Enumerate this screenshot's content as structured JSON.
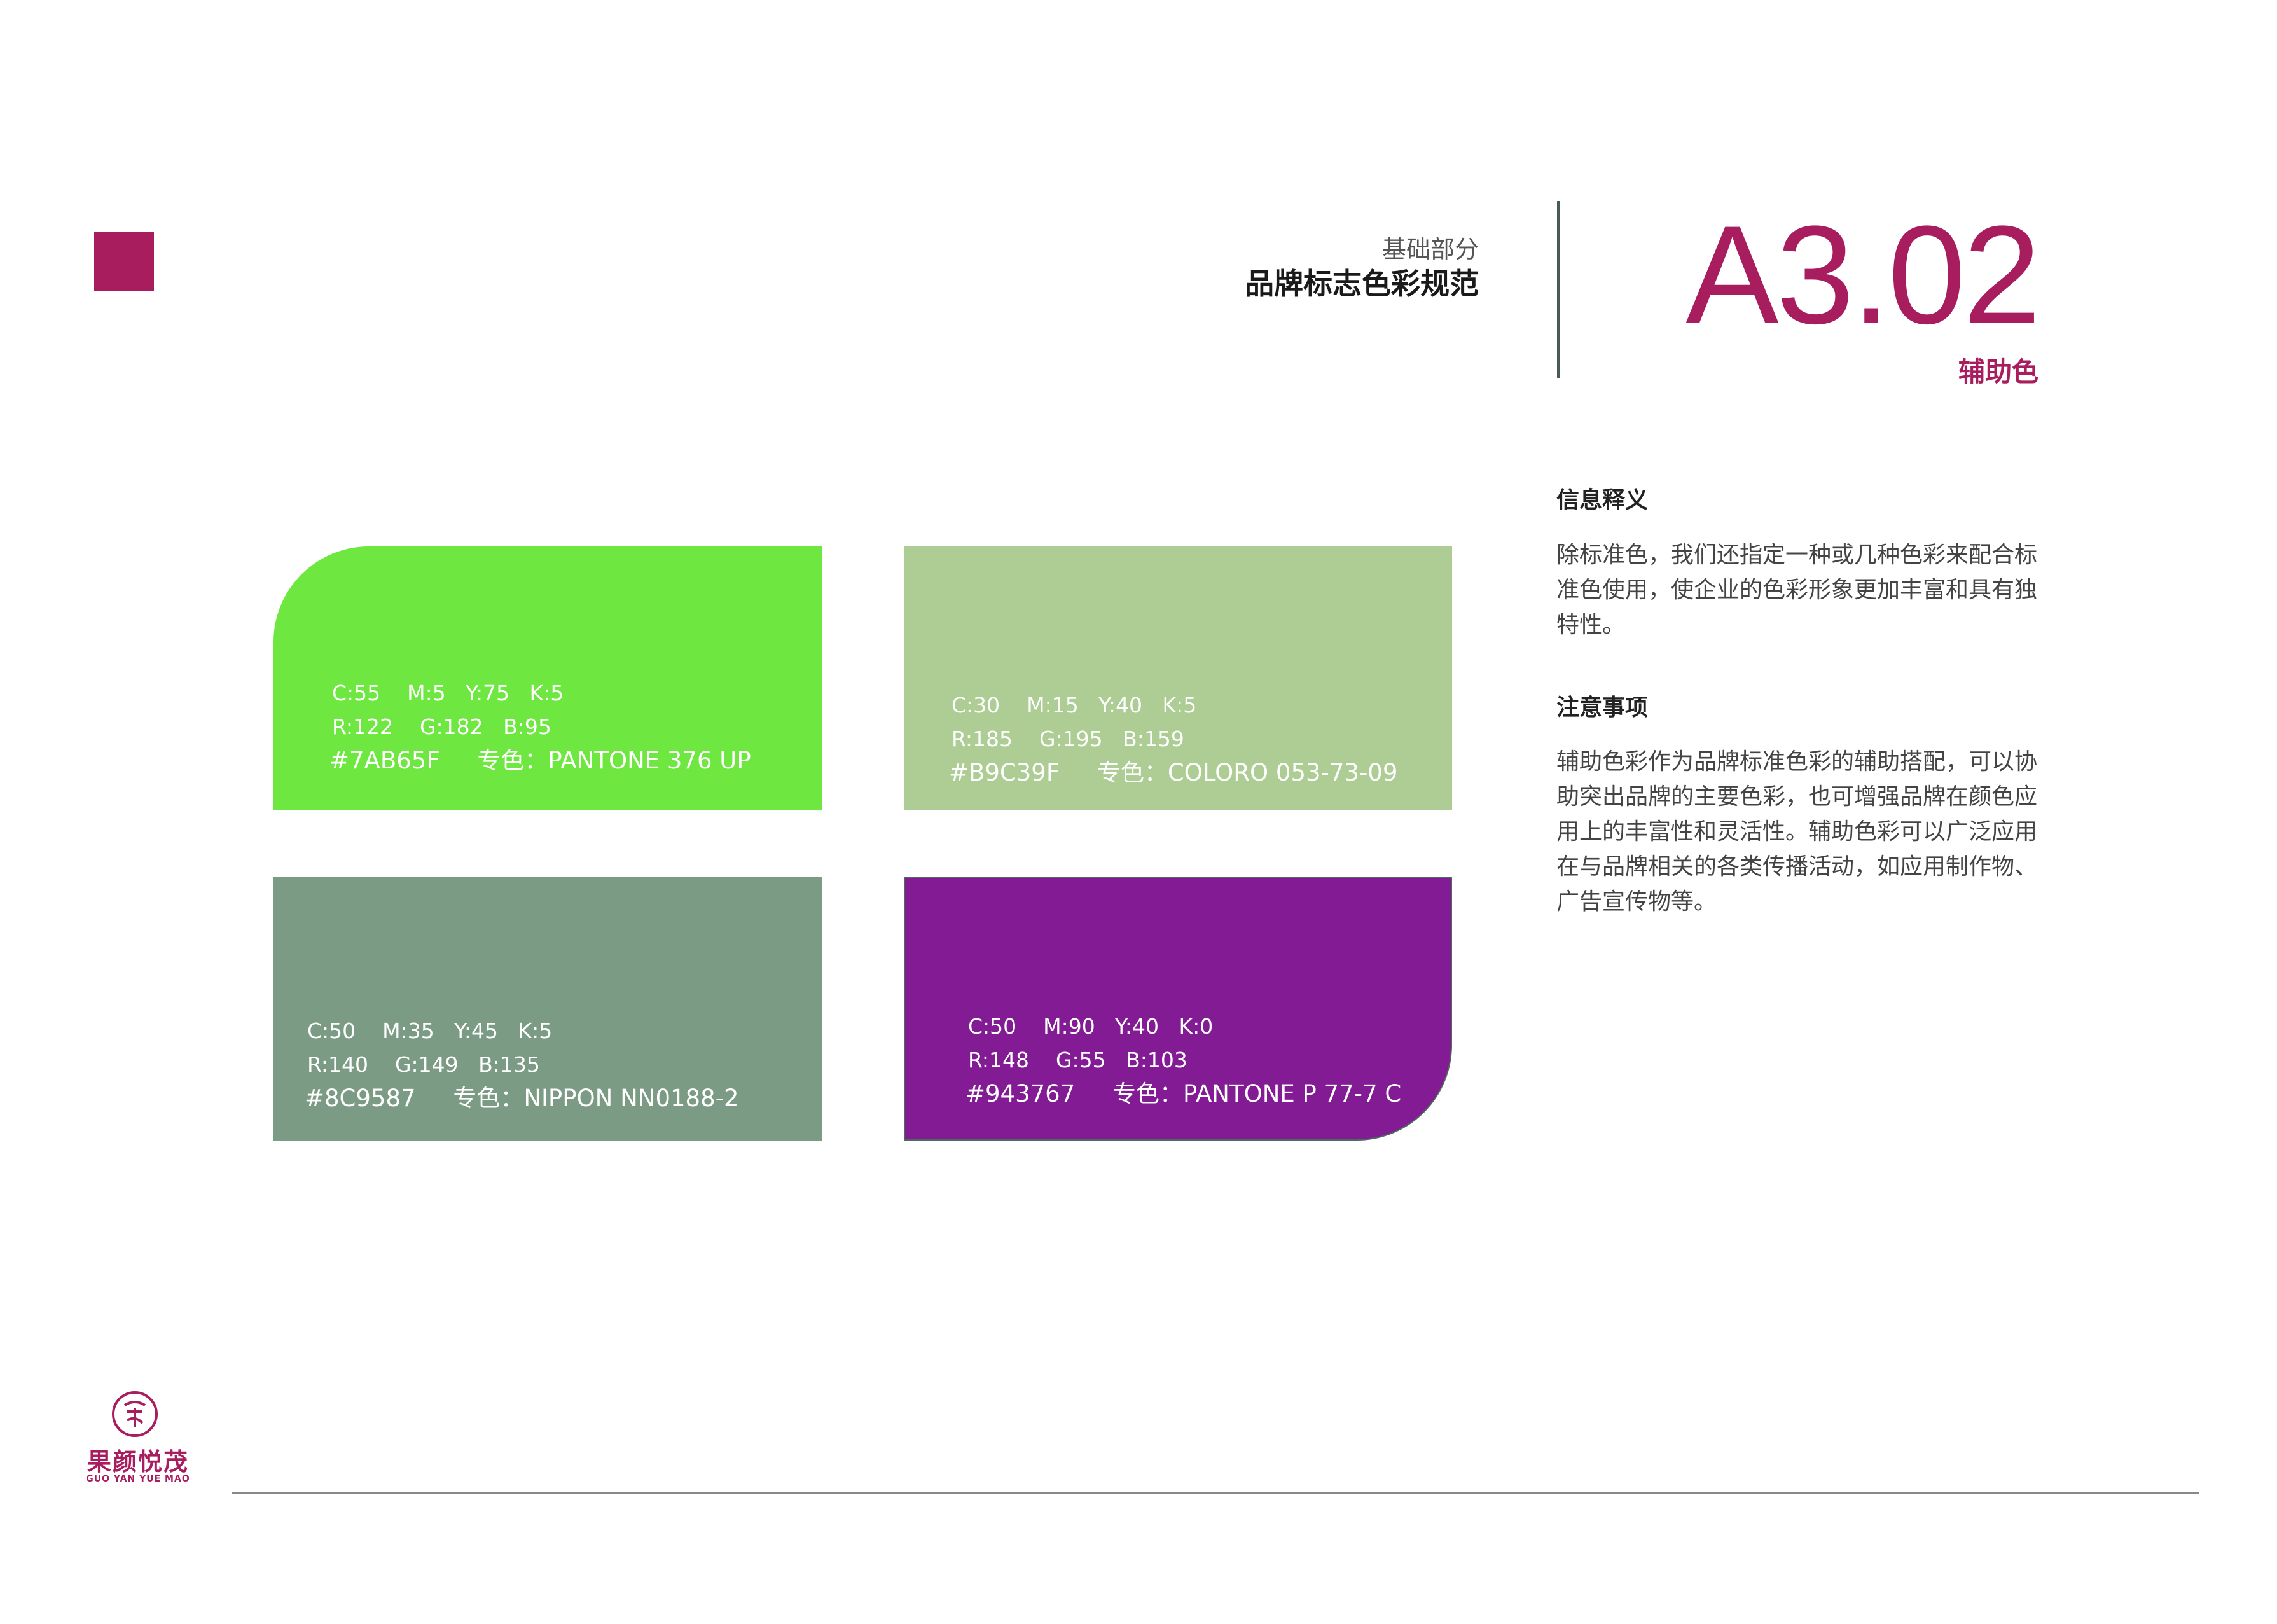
{
  "colors": {
    "brand": "#A81D5E",
    "text_dark": "#1a1a1a",
    "text_body": "#444444"
  },
  "header": {
    "section_label": "基础部分",
    "section_title": "品牌标志色彩规范",
    "page_code": "A3.02",
    "page_subtitle": "辅助色"
  },
  "info": {
    "heading1": "信息释义",
    "body1": "除标准色，我们还指定一种或几种色彩来配合标准色使用，使企业的色彩形象更加丰富和具有独特性。",
    "heading2": "注意事项",
    "body2": "辅助色彩作为品牌标准色彩的辅助搭配，可以协助突出品牌的主要色彩，也可增强品牌在颜色应用上的丰富性和灵活性。辅助色彩可以广泛应用在与品牌相关的各类传播活动，如应用制作物、广告宣传物等。"
  },
  "swatches": [
    {
      "color": "#6EE840",
      "cmyk": "C:55    M:5   Y:75   K:5",
      "rgb": "R:122    G:182   B:95",
      "hex_spot": "#7AB65F     专色：PANTONE 376 UP"
    },
    {
      "color": "#ADCD95",
      "cmyk": "C:30    M:15   Y:40   K:5",
      "rgb": "R:185    G:195   B:159",
      "hex_spot": "#B9C39F     专色：COLORO 053-73-09"
    },
    {
      "color": "#7B9B84",
      "cmyk": "C:50    M:35   Y:45   K:5",
      "rgb": "R:140    G:149   B:135",
      "hex_spot": "#8C9587     专色：NIPPON NN0188-2"
    },
    {
      "color": "#821B94",
      "cmyk": "C:50    M:90   Y:40   K:0",
      "rgb": "R:148    G:55   B:103",
      "hex_spot": "#943767     专色：PANTONE P 77-7 C"
    }
  ],
  "logo": {
    "name_cn": "果颜悦茂",
    "name_en": "GUO YAN YUE MAO"
  }
}
